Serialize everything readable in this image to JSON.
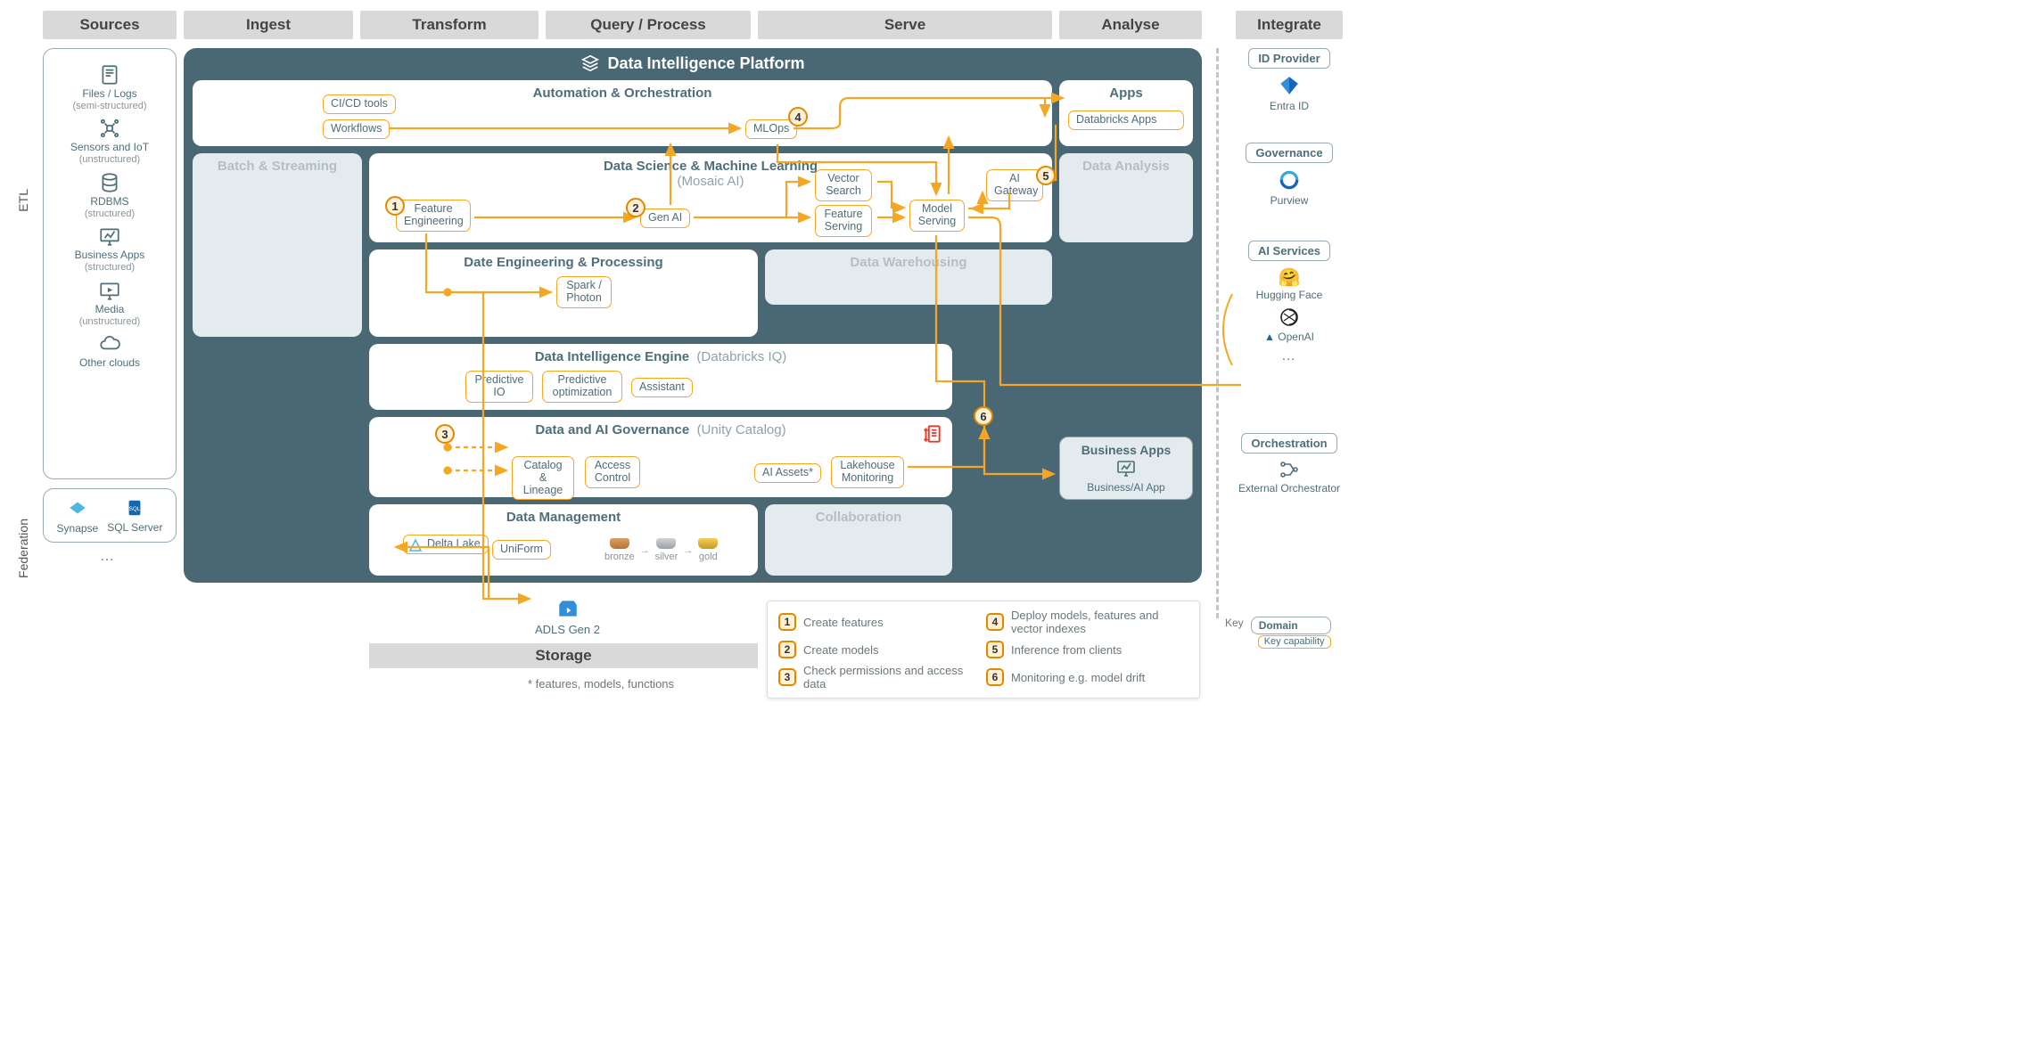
{
  "columns": {
    "sources": "Sources",
    "ingest": "Ingest",
    "transform": "Transform",
    "query": "Query / Process",
    "serve": "Serve",
    "analyse": "Analyse",
    "integrate": "Integrate"
  },
  "side": {
    "etl": "ETL",
    "federation": "Federation"
  },
  "platform_title": "Data Intelligence Platform",
  "sources": {
    "files": {
      "label": "Files / Logs",
      "sub": "(semi-structured)"
    },
    "iot": {
      "label": "Sensors and IoT",
      "sub": "(unstructured)"
    },
    "rdbms": {
      "label": "RDBMS",
      "sub": "(structured)"
    },
    "bizapps": {
      "label": "Business Apps",
      "sub": "(structured)"
    },
    "media": {
      "label": "Media",
      "sub": "(unstructured)"
    },
    "other": {
      "label": "Other clouds",
      "sub": ""
    }
  },
  "federation": {
    "synapse": "Synapse",
    "sql": "SQL Server",
    "more": "…"
  },
  "domains": {
    "automation": "Automation & Orchestration",
    "apps_title": "Apps",
    "apps_cap": "Databricks Apps",
    "batch": "Batch & Streaming",
    "ds": "Data Science & Machine Learning",
    "ds_paren": "(Mosaic AI)",
    "analysis": "Data Analysis",
    "dep": "Date Engineering & Processing",
    "dw": "Data Warehousing",
    "die": "Data Intelligence Engine",
    "die_paren": "(Databricks IQ)",
    "gov": "Data and AI Governance",
    "gov_paren": "(Unity Catalog)",
    "dm": "Data Management",
    "collab": "Collaboration"
  },
  "caps": {
    "cicd": "CI/CD tools",
    "workflows": "Workflows",
    "mlops": "MLOps",
    "feat_eng": "Feature Engineering",
    "genai": "Gen AI",
    "vector": "Vector Search",
    "feat_serv": "Feature Serving",
    "model_serv": "Model Serving",
    "ai_gw": "AI Gateway",
    "spark": "Spark / Photon",
    "pred_io": "Predictive IO",
    "pred_opt": "Predictive optimization",
    "assistant": "Assistant",
    "catalog": "Catalog & Lineage",
    "access": "Access Control",
    "ai_assets": "AI Assets*",
    "lh_mon": "Lakehouse Monitoring",
    "delta": "Delta Lake",
    "uniform": "UniForm"
  },
  "medallion": {
    "bronze": "bronze",
    "silver": "silver",
    "gold": "gold"
  },
  "storage": {
    "adls": "ADLS Gen 2",
    "bar": "Storage"
  },
  "footnote": "* features, models, functions",
  "biz_apps": {
    "title": "Business Apps",
    "item": "Business/AI App"
  },
  "integrate": {
    "id_head": "ID Provider",
    "entra": "Entra ID",
    "gov_head": "Governance",
    "purview": "Purview",
    "ai_head": "AI Services",
    "hf": "Hugging Face",
    "openai": "OpenAI",
    "more": "…",
    "orch_head": "Orchestration",
    "ext_orch": "External Orchestrator"
  },
  "legend": {
    "1": "Create features",
    "2": "Create models",
    "3": "Check permissions and access data",
    "4": "Deploy models, features and vector indexes",
    "5": "Inference from clients",
    "6": "Monitoring e.g. model drift"
  },
  "key": {
    "label": "Key",
    "domain": "Domain",
    "cap": "Key capability"
  }
}
